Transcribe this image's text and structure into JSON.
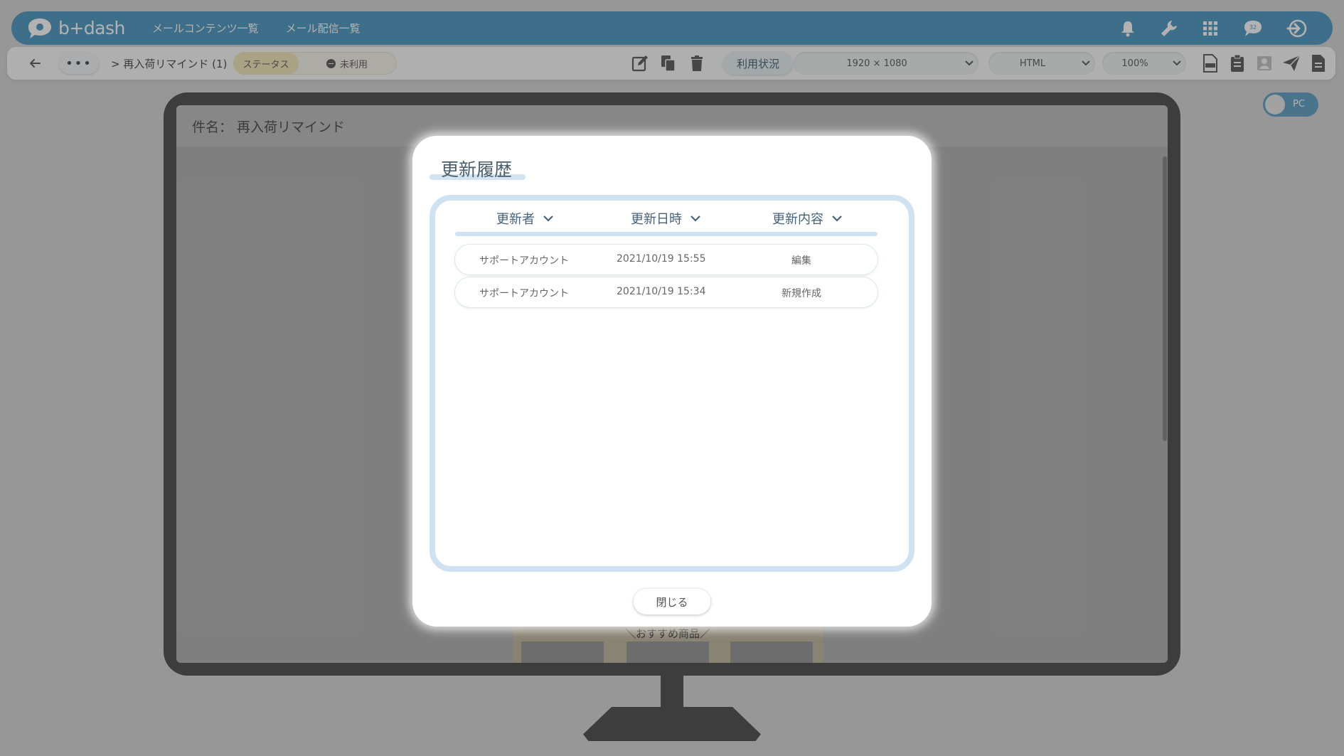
{
  "app": {
    "logo_text": "b+dash",
    "nav": [
      "メールコンテンツ一覧",
      "メール配信一覧"
    ],
    "notification_badge": "32"
  },
  "toolbar": {
    "more_label": "•••",
    "breadcrumb": "> 再入荷リマインド (1)",
    "status_label": "ステータス",
    "unused_label": "未利用",
    "usage_label": "利用状況",
    "resolution": "1920 × 1080",
    "format": "HTML",
    "zoom": "100%"
  },
  "preview": {
    "subject": "件名： 再入荷リマインド",
    "strip_text": "＼おすすめ商品／",
    "device_toggle": "PC"
  },
  "modal": {
    "title": "更新履歴",
    "columns": [
      "更新者",
      "更新日時",
      "更新内容"
    ],
    "rows": [
      {
        "user": "サポートアカウント",
        "datetime": "2021/10/19 15:55",
        "action": "編集"
      },
      {
        "user": "サポートアカウント",
        "datetime": "2021/10/19 15:34",
        "action": "新規作成"
      }
    ],
    "close_label": "閉じる"
  },
  "colors": {
    "header_blue": "#5aa0c6",
    "frame_blue": "#cfe2f2",
    "status_yellow": "#f3e8bf"
  }
}
